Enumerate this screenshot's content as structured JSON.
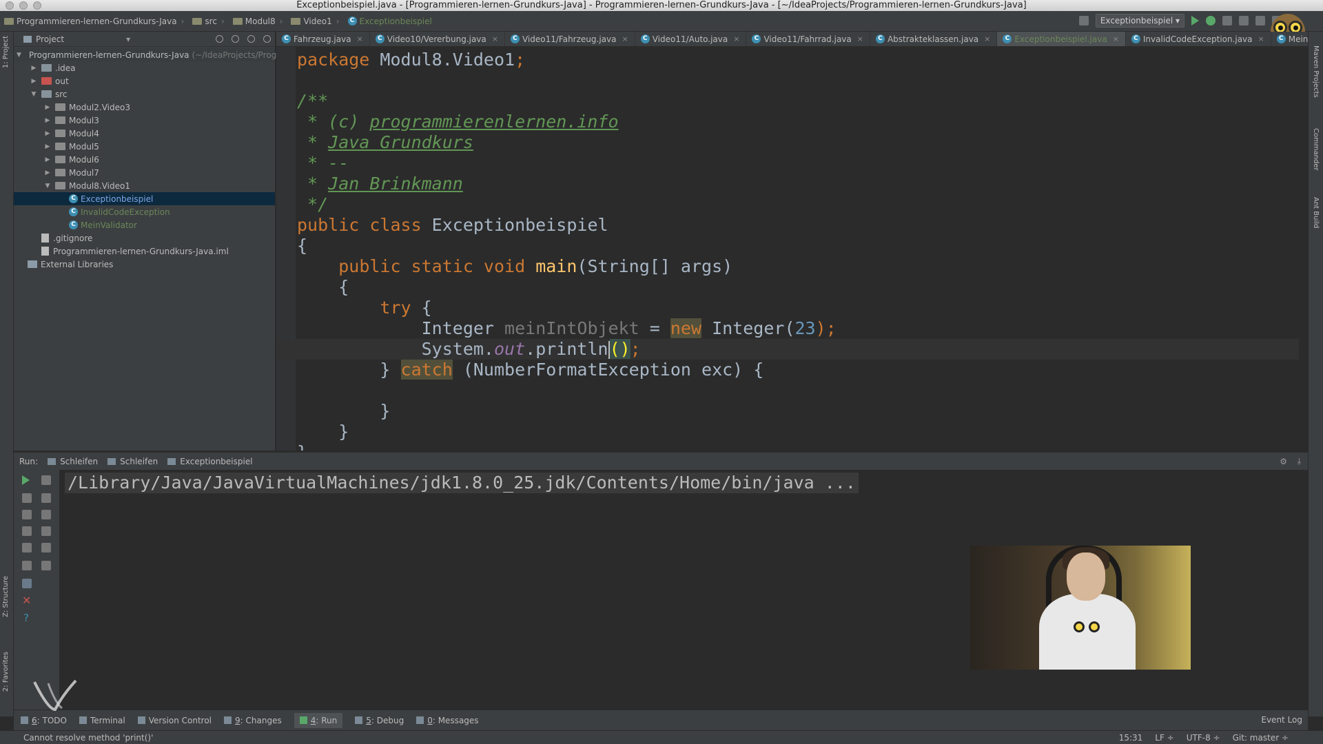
{
  "window": {
    "title": "Exceptionbeispiel.java - [Programmieren-lernen-Grundkurs-Java] - Programmieren-lernen-Grundkurs-Java - [~/IdeaProjects/Programmieren-lernen-Grundkurs-Java]"
  },
  "breadcrumb": [
    {
      "label": "Programmieren-lernen-Grundkurs-Java"
    },
    {
      "label": "src"
    },
    {
      "label": "Modul8"
    },
    {
      "label": "Video1"
    },
    {
      "label": "Exceptionbeispiel"
    }
  ],
  "toolbar": {
    "run_config": "Exceptionbeispiel"
  },
  "left_strip": {
    "project": "1: Project",
    "structure": "Z: Structure",
    "favorites": "2: Favorites"
  },
  "right_strip": {
    "maven": "Maven Projects",
    "commander": "Commander",
    "ant": "Ant Build"
  },
  "project_panel": {
    "header": "Project",
    "root": {
      "label": "Programmieren-lernen-Grundkurs-Java",
      "path": "(~/IdeaProjects/Progr"
    },
    "items": [
      {
        "label": ".idea",
        "indent": 1,
        "arrow": "▶",
        "kind": "folder"
      },
      {
        "label": "out",
        "indent": 1,
        "arrow": "▶",
        "kind": "folder-red"
      },
      {
        "label": "src",
        "indent": 1,
        "arrow": "▼",
        "kind": "folder"
      },
      {
        "label": "Modul2.Video3",
        "indent": 2,
        "arrow": "▶",
        "kind": "folder-mod"
      },
      {
        "label": "Modul3",
        "indent": 2,
        "arrow": "▶",
        "kind": "folder-mod"
      },
      {
        "label": "Modul4",
        "indent": 2,
        "arrow": "▶",
        "kind": "folder-mod"
      },
      {
        "label": "Modul5",
        "indent": 2,
        "arrow": "▶",
        "kind": "folder-mod"
      },
      {
        "label": "Modul6",
        "indent": 2,
        "arrow": "▶",
        "kind": "folder-mod"
      },
      {
        "label": "Modul7",
        "indent": 2,
        "arrow": "▶",
        "kind": "folder-mod"
      },
      {
        "label": "Modul8.Video1",
        "indent": 2,
        "arrow": "▼",
        "kind": "folder-mod"
      },
      {
        "label": "Exceptionbeispiel",
        "indent": 3,
        "arrow": "",
        "kind": "class-selected"
      },
      {
        "label": "InvalidCodeException",
        "indent": 3,
        "arrow": "",
        "kind": "class-green"
      },
      {
        "label": "MeinValidator",
        "indent": 3,
        "arrow": "",
        "kind": "class-green"
      },
      {
        "label": ".gitignore",
        "indent": 1,
        "arrow": "",
        "kind": "file"
      },
      {
        "label": "Programmieren-lernen-Grundkurs-Java.iml",
        "indent": 1,
        "arrow": "",
        "kind": "iml"
      },
      {
        "label": "External Libraries",
        "indent": 0,
        "arrow": "",
        "kind": "lib"
      }
    ]
  },
  "editor_tabs": [
    {
      "label": "Fahrzeug.java",
      "active": false
    },
    {
      "label": "Video10/Vererbung.java",
      "active": false
    },
    {
      "label": "Video11/Fahrzeug.java",
      "active": false
    },
    {
      "label": "Video11/Auto.java",
      "active": false
    },
    {
      "label": "Video11/Fahrrad.java",
      "active": false
    },
    {
      "label": "Abstrakteklassen.java",
      "active": false
    },
    {
      "label": "Exceptionbeispiel.java",
      "active": true
    },
    {
      "label": "InvalidCodeException.java",
      "active": false
    },
    {
      "label": "MeinValidator.java",
      "active": false
    }
  ],
  "code": {
    "pkg_kw": "package",
    "pkg_name": " Modul8.Video1",
    "pkg_semi": ";",
    "c1": "/**",
    "c2a": " * (c) ",
    "c2b": "programmierenlernen.info",
    "c3a": " * ",
    "c3b": "Java Grundkurs",
    "c4": " * --",
    "c5a": " * ",
    "c5b": "Jan Brinkmann",
    "c6": " */",
    "cls_kw": "public class ",
    "cls_name": "Exceptionbeispiel",
    "brace_open": "{",
    "main_indent": "    ",
    "main_kw": "public static void ",
    "main_name": "main",
    "main_rest": "(String[] args)",
    "brace2": "    {",
    "try_indent": "        ",
    "try_kw": "try",
    "try_rest": " {",
    "int_indent": "            ",
    "int_type": "Integer ",
    "int_var": "meinIntObjekt",
    "int_eq": " = ",
    "int_new": "new",
    "int_cls": " Integer(",
    "int_num": "23",
    "int_end": ");",
    "sys_indent": "            ",
    "sys_a": "System.",
    "sys_out": "out",
    "sys_b": ".println",
    "sys_paren": "()",
    "sys_semi": ";",
    "catch_a": "        } ",
    "catch_kw": "catch",
    "catch_rest": " (NumberFormatException exc) {",
    "blank": "",
    "close3": "        }",
    "close2": "    }",
    "close1": "}"
  },
  "run": {
    "label": "Run:",
    "tabs": [
      "Schleifen",
      "Schleifen",
      "Exceptionbeispiel"
    ],
    "console": "/Library/Java/JavaVirtualMachines/jdk1.8.0_25.jdk/Contents/Home/bin/java ..."
  },
  "bottom_tabs": [
    {
      "key": "6",
      "label": ": TODO"
    },
    {
      "key": "",
      "label": "Terminal"
    },
    {
      "key": "",
      "label": "Version Control"
    },
    {
      "key": "9",
      "label": ": Changes"
    },
    {
      "key": "4",
      "label": ": Run"
    },
    {
      "key": "5",
      "label": ": Debug"
    },
    {
      "key": "0",
      "label": ": Messages"
    }
  ],
  "event_log": "Event Log",
  "status": {
    "message": "Cannot resolve method 'print()'",
    "position": "15:31",
    "line_sep": "LF ÷",
    "encoding": "UTF-8 ÷",
    "vcs": "Git: master ÷"
  },
  "colors": {
    "accent_green": "#6a8759",
    "keyword": "#cc7832",
    "comment": "#629755",
    "bg": "#2b2b2b"
  }
}
